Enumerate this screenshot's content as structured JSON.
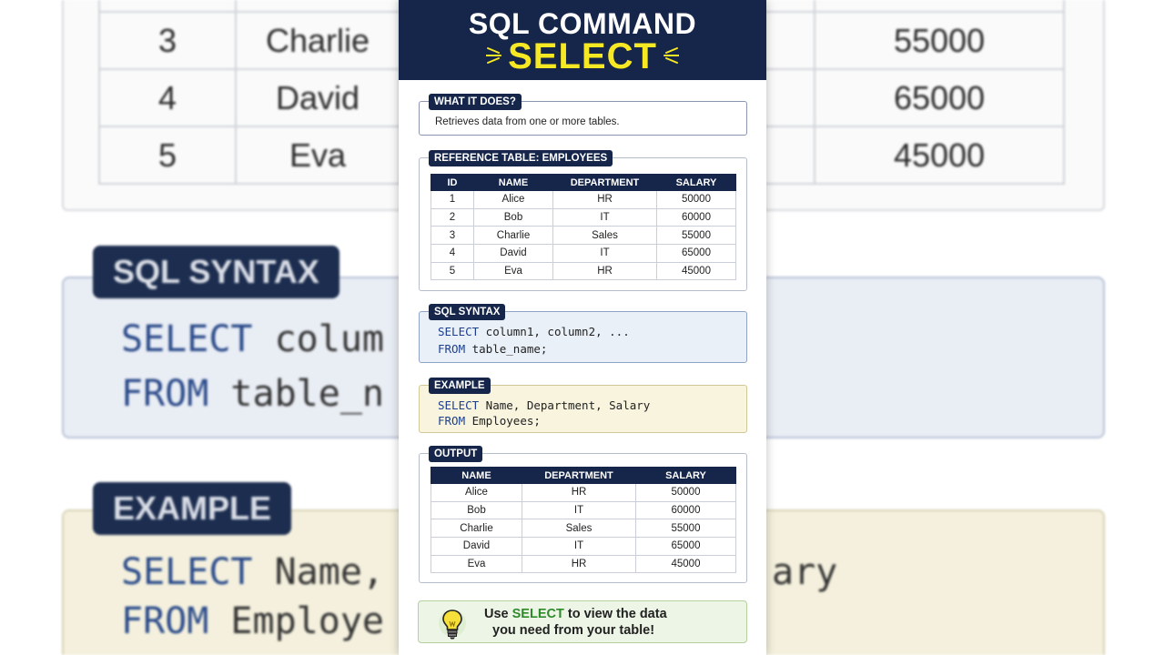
{
  "background": {
    "top_table_rows": [
      [
        "3",
        "Charlie",
        "55000"
      ],
      [
        "4",
        "David",
        "65000"
      ],
      [
        "5",
        "Eva",
        "45000"
      ]
    ],
    "syntax_tag": "SQL SYNTAX",
    "syntax_line1_kw": "SELECT",
    "syntax_line1_rest": " colum",
    "syntax_line2_kw": "FROM",
    "syntax_line2_rest": " table_n",
    "example_tag": "EXAMPLE",
    "example_line1_kw": "SELECT",
    "example_line1_rest": " Name,",
    "example_line1_tail": "ary",
    "example_line2_kw": "FROM",
    "example_line2_rest": " Employe"
  },
  "header": {
    "line1": "SQL COMMAND",
    "line2": "SELECT"
  },
  "what_it_does": {
    "tag": "WHAT IT DOES?",
    "text": "Retrieves data from one or more tables."
  },
  "reference_table": {
    "tag": "REFERENCE TABLE: EMPLOYEES",
    "columns": [
      "ID",
      "NAME",
      "DEPARTMENT",
      "SALARY"
    ],
    "rows": [
      [
        "1",
        "Alice",
        "HR",
        "50000"
      ],
      [
        "2",
        "Bob",
        "IT",
        "60000"
      ],
      [
        "3",
        "Charlie",
        "Sales",
        "55000"
      ],
      [
        "4",
        "David",
        "IT",
        "65000"
      ],
      [
        "5",
        "Eva",
        "HR",
        "45000"
      ]
    ]
  },
  "syntax": {
    "tag": "SQL SYNTAX",
    "line1_kw": "SELECT",
    "line1_rest": " column1, column2, ...",
    "line2_kw": "FROM",
    "line2_rest": " table_name;"
  },
  "example": {
    "tag": "EXAMPLE",
    "line1_kw": "SELECT",
    "line1_rest": " Name, Department, Salary",
    "line2_kw": "FROM",
    "line2_rest": " Employees;"
  },
  "output": {
    "tag": "OUTPUT",
    "columns": [
      "NAME",
      "DEPARTMENT",
      "SALARY"
    ],
    "rows": [
      [
        "Alice",
        "HR",
        "50000"
      ],
      [
        "Bob",
        "IT",
        "60000"
      ],
      [
        "Charlie",
        "Sales",
        "55000"
      ],
      [
        "David",
        "IT",
        "65000"
      ],
      [
        "Eva",
        "HR",
        "45000"
      ]
    ]
  },
  "tip": {
    "icon": "lightbulb-icon",
    "pre": "Use ",
    "highlight": "SELECT",
    "post": " to view the data",
    "line2": "you need from your table!"
  },
  "colors": {
    "navy": "#15264a",
    "yellow": "#f7e824",
    "keyword_blue": "#1d3f8f",
    "tip_green": "#2e8a2a"
  }
}
